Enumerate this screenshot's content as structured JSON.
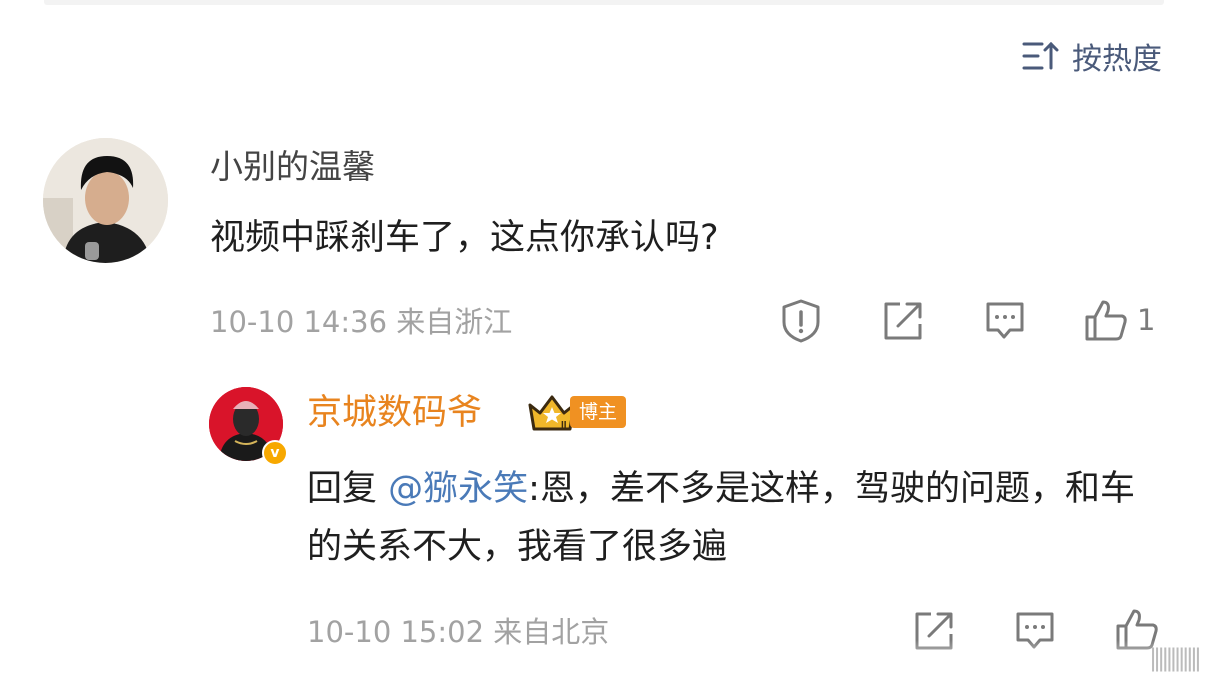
{
  "sort": {
    "label": "按热度",
    "icon": "sort-icon"
  },
  "comments": [
    {
      "username": "小别的温馨",
      "text": "视频中踩刹车了，这点你承认吗?",
      "timestamp": "10-10 14:36",
      "location": "来自浙江",
      "like_count": "1",
      "actions": [
        "report-icon",
        "share-icon",
        "reply-icon",
        "like-icon"
      ]
    }
  ],
  "reply": {
    "username": "京城数码爷",
    "badge": "博主",
    "reply_prefix": "回复",
    "mention": "@猕永笑",
    "text": ":恩，差不多是这样，驾驶的问题，和车的关系不大，我看了很多遍",
    "timestamp": "10-10 15:02",
    "location": "来自北京",
    "verified_mark": "v",
    "actions": [
      "share-icon",
      "reply-icon",
      "like-icon"
    ]
  },
  "colors": {
    "accent_orange": "#e8841f",
    "mention_blue": "#4a7ab8",
    "meta_gray": "#a2a2a2"
  }
}
